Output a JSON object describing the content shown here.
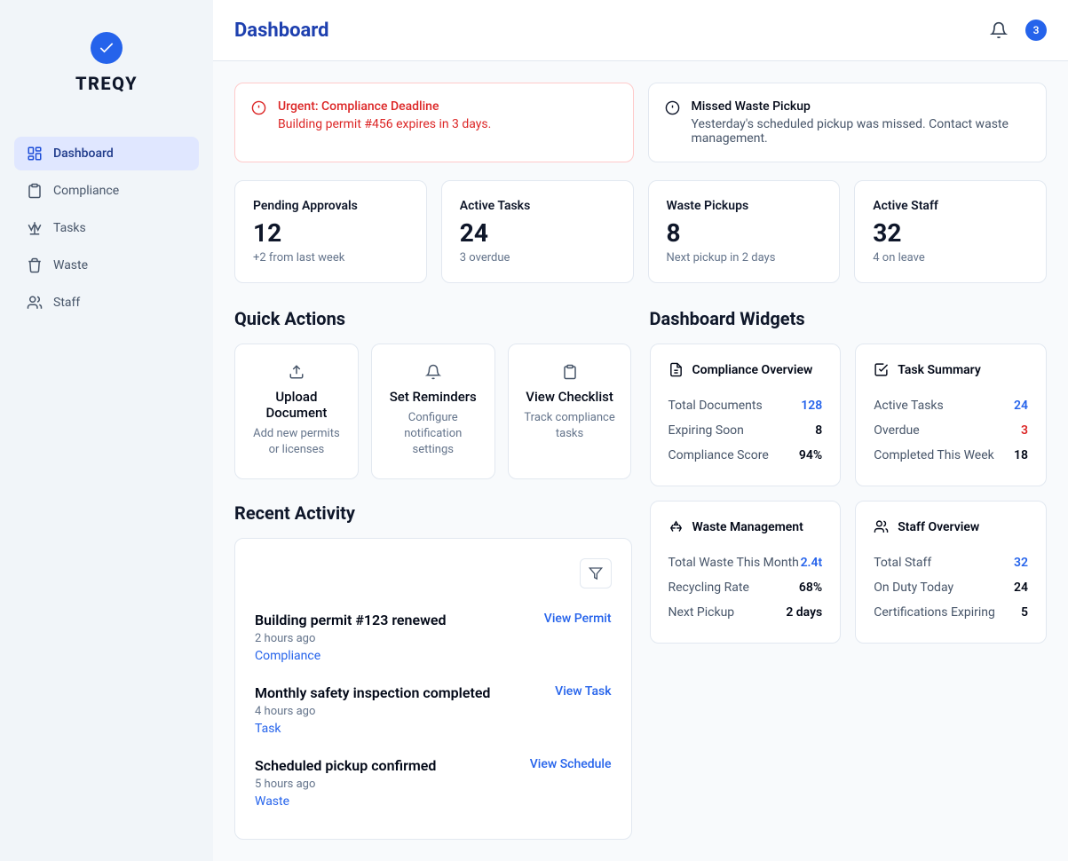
{
  "brand": {
    "name": "TREQY"
  },
  "header": {
    "title": "Dashboard",
    "notification_count": "3"
  },
  "sidebar": {
    "items": [
      {
        "label": "Dashboard",
        "icon": "dashboard",
        "active": true
      },
      {
        "label": "Compliance",
        "icon": "clipboard",
        "active": false
      },
      {
        "label": "Tasks",
        "icon": "scales",
        "active": false
      },
      {
        "label": "Waste",
        "icon": "trash",
        "active": false
      },
      {
        "label": "Staff",
        "icon": "users",
        "active": false
      }
    ]
  },
  "alerts": [
    {
      "title": "Urgent: Compliance Deadline",
      "body": "Building permit #456 expires in 3 days.",
      "variant": "red",
      "icon": "alert-circle"
    },
    {
      "title": "Missed Waste Pickup",
      "body": "Yesterday's scheduled pickup was missed. Contact waste management.",
      "variant": "default",
      "icon": "alert-circle"
    }
  ],
  "stats": [
    {
      "label": "Pending Approvals",
      "value": "12",
      "sub": "+2 from last week"
    },
    {
      "label": "Active Tasks",
      "value": "24",
      "sub": "3 overdue"
    },
    {
      "label": "Waste Pickups",
      "value": "8",
      "sub": "Next pickup in 2 days"
    },
    {
      "label": "Active Staff",
      "value": "32",
      "sub": "4 on leave"
    }
  ],
  "sections": {
    "quick_actions": "Quick Actions",
    "recent_activity": "Recent Activity",
    "widgets": "Dashboard Widgets"
  },
  "quick_actions": [
    {
      "title": "Upload Document",
      "desc": "Add new permits or licenses",
      "icon": "upload"
    },
    {
      "title": "Set Reminders",
      "desc": "Configure notification settings",
      "icon": "bell"
    },
    {
      "title": "View Checklist",
      "desc": "Track compliance tasks",
      "icon": "clipboard"
    }
  ],
  "widgets": [
    {
      "title": "Compliance Overview",
      "icon": "file",
      "rows": [
        {
          "k": "Total Documents",
          "v": "128",
          "style": "blue"
        },
        {
          "k": "Expiring Soon",
          "v": "8",
          "style": ""
        },
        {
          "k": "Compliance Score",
          "v": "94%",
          "style": ""
        }
      ]
    },
    {
      "title": "Task Summary",
      "icon": "check-square",
      "rows": [
        {
          "k": "Active Tasks",
          "v": "24",
          "style": "blue"
        },
        {
          "k": "Overdue",
          "v": "3",
          "style": "red"
        },
        {
          "k": "Completed This Week",
          "v": "18",
          "style": ""
        }
      ]
    },
    {
      "title": "Waste Management",
      "icon": "recycle",
      "rows": [
        {
          "k": "Total Waste This Month",
          "v": "2.4t",
          "style": "blue"
        },
        {
          "k": "Recycling Rate",
          "v": "68%",
          "style": ""
        },
        {
          "k": "Next Pickup",
          "v": "2 days",
          "style": ""
        }
      ]
    },
    {
      "title": "Staff Overview",
      "icon": "users",
      "rows": [
        {
          "k": "Total Staff",
          "v": "32",
          "style": "blue"
        },
        {
          "k": "On Duty Today",
          "v": "24",
          "style": ""
        },
        {
          "k": "Certifications Expiring",
          "v": "5",
          "style": ""
        }
      ]
    }
  ],
  "activity": [
    {
      "title": "Building permit #123 renewed",
      "time": "2 hours ago",
      "category": "Compliance",
      "action": "View Permit"
    },
    {
      "title": "Monthly safety inspection completed",
      "time": "4 hours ago",
      "category": "Task",
      "action": "View Task"
    },
    {
      "title": "Scheduled pickup confirmed",
      "time": "5 hours ago",
      "category": "Waste",
      "action": "View Schedule"
    }
  ]
}
